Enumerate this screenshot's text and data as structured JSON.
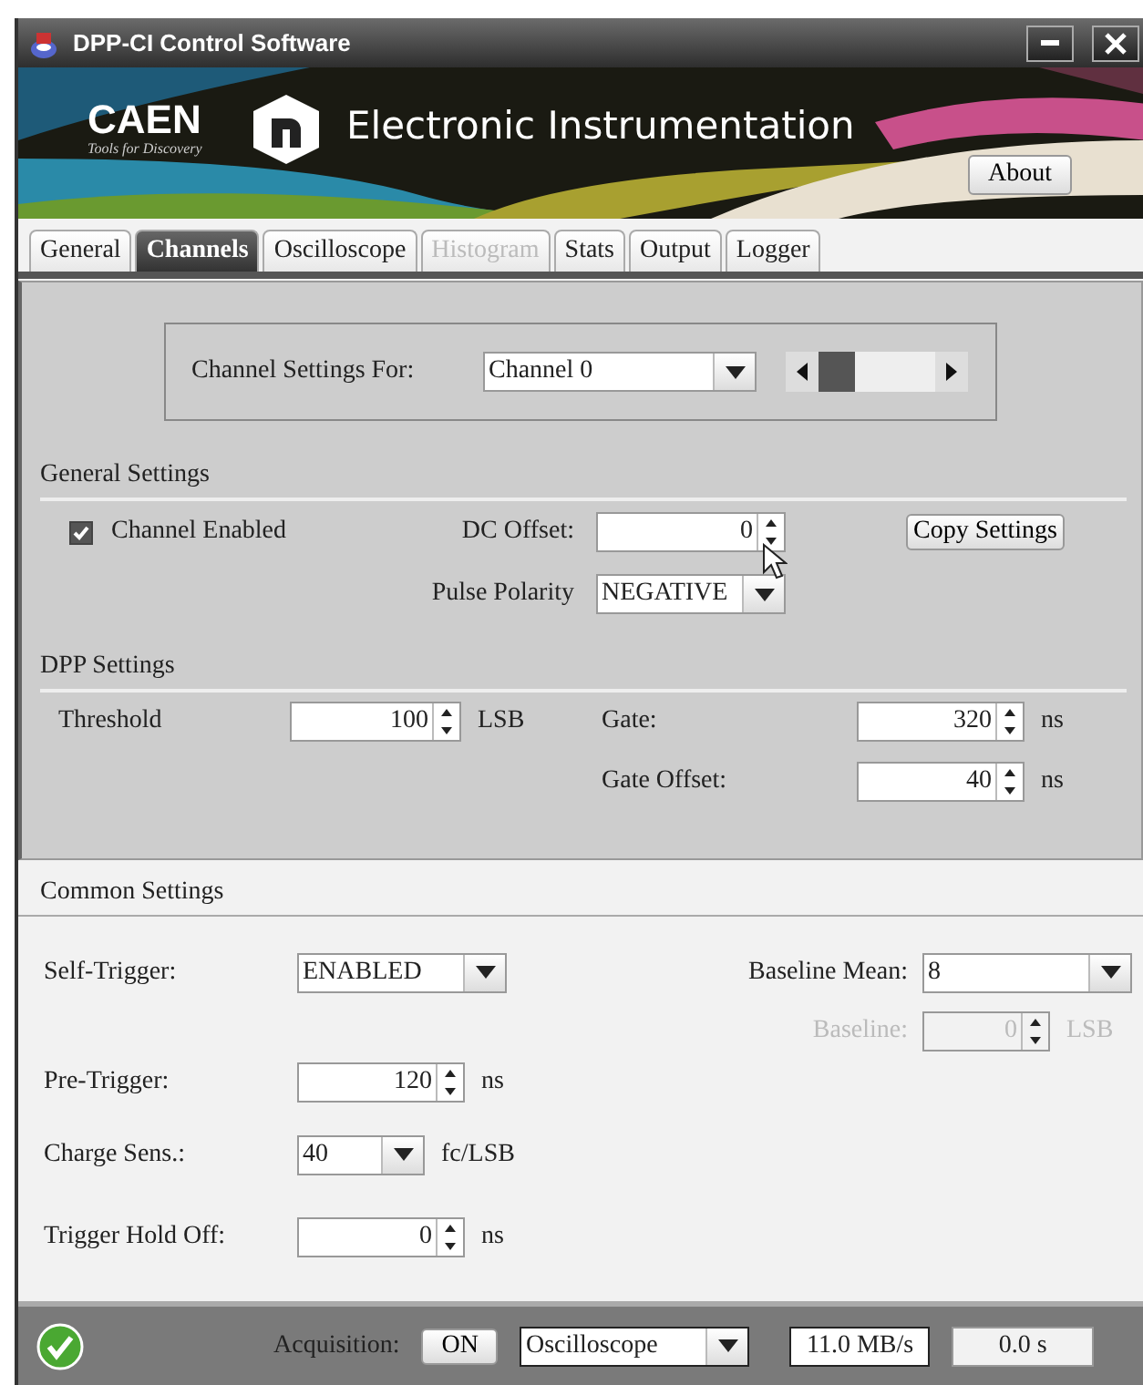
{
  "window": {
    "title": "DPP-CI Control Software"
  },
  "banner": {
    "brand": "CAEN",
    "tagline": "Tools for Discovery",
    "heading": "Electronic Instrumentation",
    "about_button": "About"
  },
  "tabs": [
    {
      "label": "General",
      "selected": false,
      "disabled": false
    },
    {
      "label": "Channels",
      "selected": true,
      "disabled": false
    },
    {
      "label": "Oscilloscope",
      "selected": false,
      "disabled": false
    },
    {
      "label": "Histogram",
      "selected": false,
      "disabled": true
    },
    {
      "label": "Stats",
      "selected": false,
      "disabled": false
    },
    {
      "label": "Output",
      "selected": false,
      "disabled": false
    },
    {
      "label": "Logger",
      "selected": false,
      "disabled": false
    }
  ],
  "channel_selector": {
    "label": "Channel Settings For:",
    "value": "Channel 0"
  },
  "general_settings": {
    "title": "General Settings",
    "channel_enabled": {
      "label": "Channel Enabled",
      "checked": true
    },
    "dc_offset": {
      "label": "DC Offset:",
      "value": "0"
    },
    "copy_button": "Copy Settings",
    "pulse_polarity": {
      "label": "Pulse Polarity",
      "value": "NEGATIVE"
    }
  },
  "dpp_settings": {
    "title": "DPP Settings",
    "threshold": {
      "label": "Threshold",
      "value": "100",
      "unit": "LSB"
    },
    "gate": {
      "label": "Gate:",
      "value": "320",
      "unit": "ns"
    },
    "gate_offset": {
      "label": "Gate Offset:",
      "value": "40",
      "unit": "ns"
    }
  },
  "common_settings": {
    "title": "Common Settings",
    "self_trigger": {
      "label": "Self-Trigger:",
      "value": "ENABLED"
    },
    "baseline_mean": {
      "label": "Baseline Mean:",
      "value": "8"
    },
    "baseline": {
      "label": "Baseline:",
      "value": "0",
      "unit": "LSB",
      "disabled": true
    },
    "pre_trigger": {
      "label": "Pre-Trigger:",
      "value": "120",
      "unit": "ns"
    },
    "charge_sens": {
      "label": "Charge Sens.:",
      "value": "40",
      "unit": "fc/LSB"
    },
    "trigger_hold_off": {
      "label": "Trigger Hold Off:",
      "value": "0",
      "unit": "ns"
    }
  },
  "status_bar": {
    "acquisition_label": "Acquisition:",
    "acquisition_button": "ON",
    "mode": "Oscilloscope",
    "rate": "11.0 MB/s",
    "time": "0.0 s"
  }
}
